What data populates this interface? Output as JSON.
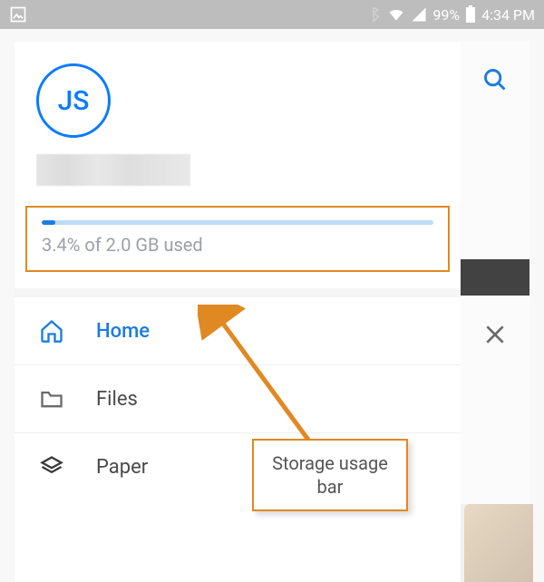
{
  "status_bar": {
    "battery_pct": "99%",
    "time": "4:34 PM"
  },
  "profile": {
    "initials": "JS"
  },
  "storage": {
    "text": "3.4% of 2.0 GB used",
    "percent": 3.4
  },
  "nav": {
    "home": "Home",
    "files": "Files",
    "paper": "Paper"
  },
  "callout": {
    "text": "Storage usage bar"
  }
}
